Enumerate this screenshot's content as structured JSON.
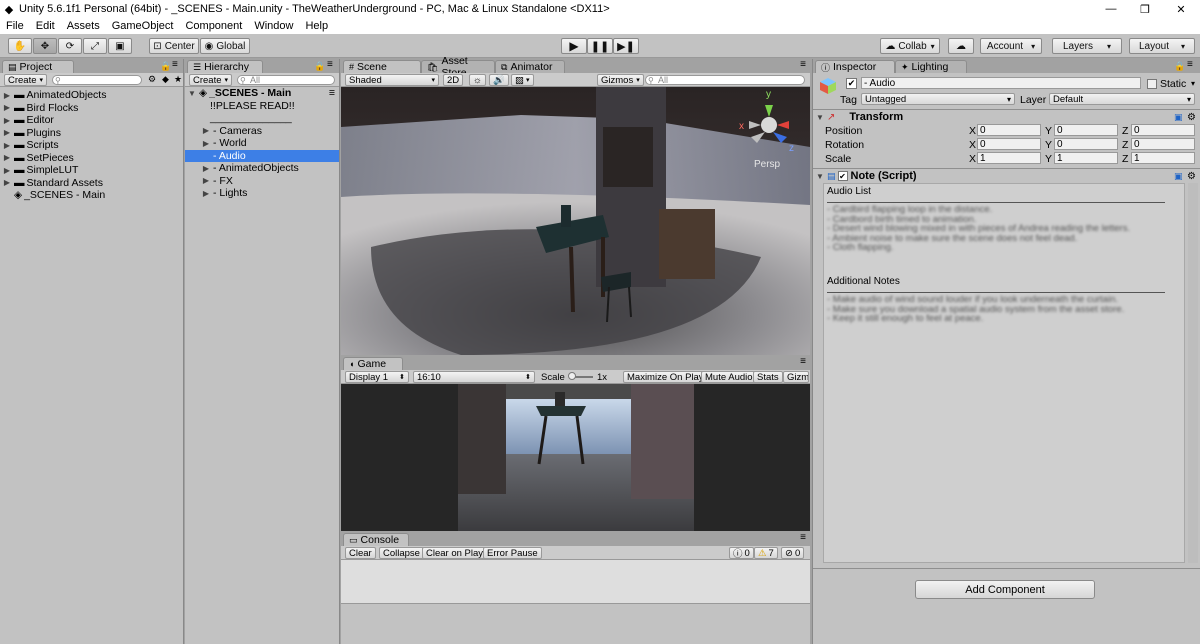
{
  "window": {
    "title": "Unity 5.6.1f1 Personal (64bit) - _SCENES - Main.unity - TheWeatherUnderground - PC, Mac & Linux Standalone <DX11>"
  },
  "menu": [
    "File",
    "Edit",
    "Assets",
    "GameObject",
    "Component",
    "Window",
    "Help"
  ],
  "toolbar": {
    "center": "Center",
    "global": "Global",
    "collab": "Collab",
    "account": "Account",
    "layers": "Layers",
    "layout": "Layout"
  },
  "project": {
    "tab": "Project",
    "create": "Create",
    "items": [
      "AnimatedObjects",
      "Bird Flocks",
      "Editor",
      "Plugins",
      "Scripts",
      "SetPieces",
      "SimpleLUT",
      "Standard Assets"
    ],
    "scene_item": "_SCENES - Main"
  },
  "hierarchy": {
    "tab": "Hierarchy",
    "create": "Create",
    "search_placeholder": "All",
    "root": "_SCENES - Main",
    "read": "!!PLEASE READ!!",
    "sep": "______________",
    "items": [
      "- Cameras",
      "- World",
      "- Audio",
      "- AnimatedObjects",
      "- FX",
      "- Lights"
    ]
  },
  "scene": {
    "tabs": [
      "Scene",
      "Asset Store",
      "Animator"
    ],
    "shaded": "Shaded",
    "mode2d": "2D",
    "gizmos": "Gizmos",
    "search_placeholder": "All",
    "persp": "Persp",
    "axes": {
      "y": "y",
      "x": "x",
      "z": "z"
    }
  },
  "game": {
    "tab": "Game",
    "display": "Display 1",
    "aspect": "16:10",
    "scale_label": "Scale",
    "scale_value": "1x",
    "maximize": "Maximize On Play",
    "mute": "Mute Audio",
    "stats": "Stats",
    "gizmos": "Gizmo"
  },
  "console": {
    "tab": "Console",
    "clear": "Clear",
    "collapse": "Collapse",
    "clear_on_play": "Clear on Play",
    "error_pause": "Error Pause",
    "counts": [
      "0",
      "7",
      "0"
    ]
  },
  "inspector": {
    "tabs": [
      "Inspector",
      "Lighting"
    ],
    "object_name": "- Audio",
    "static": "Static",
    "tag_label": "Tag",
    "tag": "Untagged",
    "layer_label": "Layer",
    "layer": "Default",
    "transform": {
      "title": "Transform",
      "rows": [
        {
          "label": "Position",
          "x": "0",
          "y": "0",
          "z": "0"
        },
        {
          "label": "Rotation",
          "x": "0",
          "y": "0",
          "z": "0"
        },
        {
          "label": "Scale",
          "x": "1",
          "y": "1",
          "z": "1"
        }
      ]
    },
    "note": {
      "title": "Note (Script)",
      "audio_list": "Audio List",
      "audio_items": [
        "- Cardbird flapping loop in the distance.",
        "- Cardbord birth timed to animation.",
        "- Desert wind blowing mixed in with pieces of Andrea reading the letters.",
        "- Ambient noise to make sure the scene does not feel dead.",
        "- Cloth flapping."
      ],
      "additional": "Additional Notes",
      "additional_items": [
        "- Make audio of wind sound louder if you look underneath the curtain.",
        "- Make sure you download a spatial audio system from the asset store.",
        "- Keep it still enough to feel at peace."
      ]
    },
    "add_component": "Add Component"
  }
}
